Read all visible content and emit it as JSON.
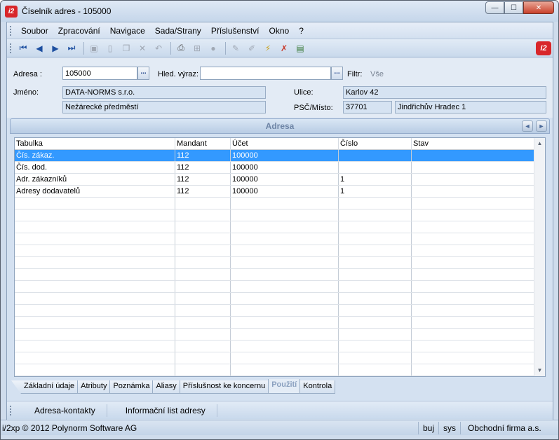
{
  "window": {
    "title": "Číselník adres - 105000",
    "logo": "i2",
    "buttons": {
      "minimize": "—",
      "maximize": "☐",
      "close": "✕"
    }
  },
  "menu": [
    "Soubor",
    "Zpracování",
    "Navigace",
    "Sada/Strany",
    "Příslušenství",
    "Okno",
    "?"
  ],
  "toolbar": {
    "icons": [
      "first-record-icon",
      "prev-record-icon",
      "next-record-icon",
      "last-record-icon",
      "save-icon",
      "new-icon",
      "copy-icon",
      "delete-icon",
      "undo-icon",
      "print-icon",
      "tree-icon",
      "disabled-icon",
      "edit-pen-icon",
      "edit-pen2-icon",
      "filter-icon",
      "filter-remove-icon",
      "report-icon"
    ],
    "logo": "i2"
  },
  "form": {
    "adresa_label": "Adresa :",
    "adresa_value": "105000",
    "hled_label": "Hled. výraz:",
    "hled_value": "",
    "filtr_label": "Filtr:",
    "filtr_value": "Vše",
    "jmeno_label": "Jméno:",
    "jmeno_value1": "DATA-NORMS s.r.o.",
    "jmeno_value2": "Nežárecké předměstí",
    "ulice_label": "Ulice:",
    "ulice_value": "Karlov 42",
    "psc_label": "PSČ/Místo:",
    "psc_value": "37701",
    "misto_value": "Jindřichův Hradec 1",
    "dots": "..."
  },
  "section": {
    "title": "Adresa",
    "prev": "◄",
    "next": "►"
  },
  "grid": {
    "columns": [
      "Tabulka",
      "Mandant",
      "Účet",
      "Číslo",
      "Stav"
    ],
    "rows": [
      [
        "Čís. zákaz.",
        "112",
        "100000",
        "",
        ""
      ],
      [
        "Čís. dod.",
        "112",
        "100000",
        "",
        ""
      ],
      [
        "Adr. zákazníků",
        "112",
        "100000",
        "1",
        ""
      ],
      [
        "Adresy dodavatelů",
        "112",
        "100000",
        "1",
        ""
      ]
    ],
    "selected_row": 0,
    "empty_rows": 15
  },
  "tabs": [
    "Základní údaje",
    "Atributy",
    "Poznámka",
    "Aliasy",
    "Příslušnost ke koncernu",
    "Použití",
    "Kontrola"
  ],
  "active_tab": 5,
  "bottom_links": [
    "Adresa-kontakty",
    "Informační list adresy"
  ],
  "status": {
    "copyright": "i/2xp © 2012 Polynorm Software AG",
    "user": "buj",
    "db": "sys",
    "firm": "Obchodní firma a.s."
  }
}
